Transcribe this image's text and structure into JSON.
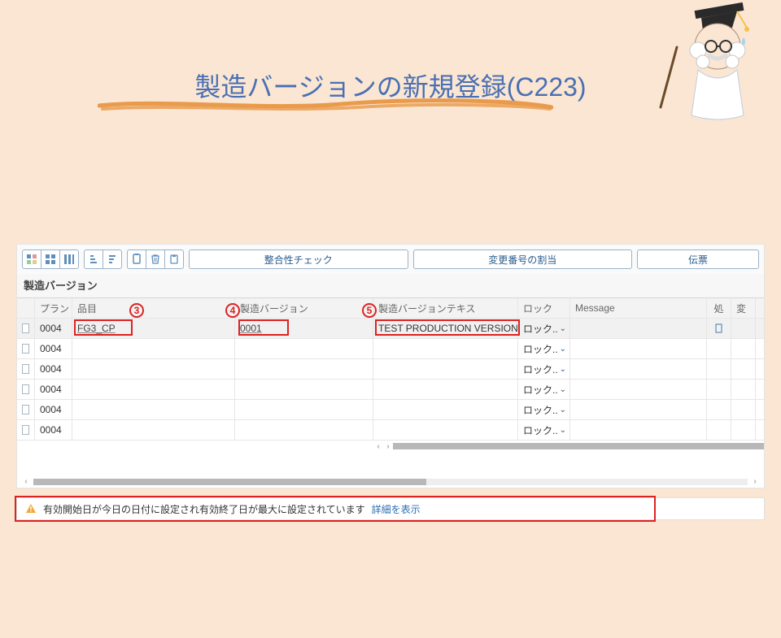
{
  "title": "製造バージョンの新規登録(C223)",
  "toolbar": {
    "consistency_check": "整合性チェック",
    "change_number_assign": "変更番号の割当",
    "slip": "伝票"
  },
  "panel_title": "製造バージョン",
  "columns": {
    "plant": "プラント",
    "item": "品目",
    "version": "製造バージョン",
    "version_text": "製造バージョンテキス",
    "lock": "ロック",
    "message": "Message",
    "proc": "処",
    "change": "変"
  },
  "rows": [
    {
      "plant": "0004",
      "item": "FG3_CP",
      "version": "0001",
      "version_text": "TEST PRODUCTION VERSION",
      "lock": "ロック..",
      "first": true
    },
    {
      "plant": "0004",
      "item": "",
      "version": "",
      "version_text": "",
      "lock": "ロック.."
    },
    {
      "plant": "0004",
      "item": "",
      "version": "",
      "version_text": "",
      "lock": "ロック.."
    },
    {
      "plant": "0004",
      "item": "",
      "version": "",
      "version_text": "",
      "lock": "ロック.."
    },
    {
      "plant": "0004",
      "item": "",
      "version": "",
      "version_text": "",
      "lock": "ロック.."
    },
    {
      "plant": "0004",
      "item": "",
      "version": "",
      "version_text": "",
      "lock": "ロック.."
    }
  ],
  "annotations": {
    "a3": "3",
    "a4": "4",
    "a5": "5"
  },
  "message_bar": {
    "text": "有効開始日が今日の日付に設定され有効終了日が最大に設定されています",
    "link": "詳細を表示"
  }
}
